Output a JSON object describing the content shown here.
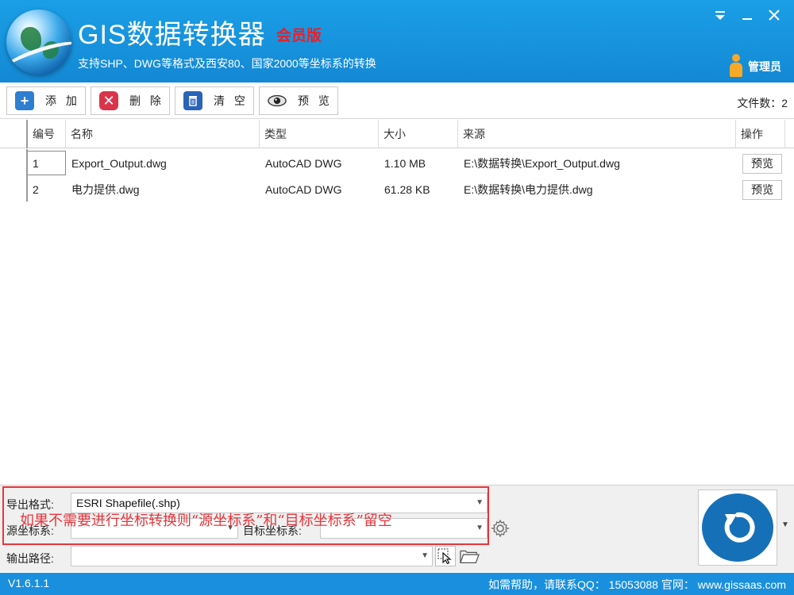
{
  "header": {
    "title": "GIS数据转换器",
    "edition": "会员版",
    "subtitle": "支持SHP、DWG等格式及西安80、国家2000等坐标系的转换",
    "user_label": "管理员",
    "window_buttons": {
      "menu": "menu-icon",
      "minimize": "minimize-icon",
      "close": "close-icon"
    }
  },
  "toolbar": {
    "add_label": "添 加",
    "delete_label": "删 除",
    "clear_label": "清 空",
    "preview_label": "预 览",
    "file_count": "文件数：2",
    "colors": {
      "add": "#2f7fd0",
      "delete": "#d9344a",
      "clear": "#2a64b8"
    }
  },
  "table": {
    "columns": [
      "编号",
      "名称",
      "类型",
      "大小",
      "来源",
      "操作"
    ],
    "rows": [
      {
        "num": "1",
        "name": "Export_Output.dwg",
        "type": "AutoCAD DWG",
        "size": "1.10 MB",
        "source": "E:\\数据转换\\Export_Output.dwg",
        "action": "预览"
      },
      {
        "num": "2",
        "name": "电力提供.dwg",
        "type": "AutoCAD DWG",
        "size": "61.28 KB",
        "source": "E:\\数据转换\\电力提供.dwg",
        "action": "预览"
      }
    ]
  },
  "bottom": {
    "export_format_label": "导出格式:",
    "export_format_value": "ESRI Shapefile(.shp)",
    "source_crs_label": "源坐标系:",
    "source_crs_value": "",
    "target_crs_label": "目标坐标系:",
    "target_crs_value": "",
    "output_path_label": "输出路径:",
    "output_path_value": "",
    "hint": "如果不需要进行坐标转换则“源坐标系”和“目标坐标系”留空"
  },
  "status": {
    "version": "V1.6.1.1",
    "help": "如需帮助，请联系QQ：  15053088   官网：  www.gissaas.com"
  },
  "colors": {
    "header": "#1a9fe6",
    "status": "#1a8fde",
    "accent_red": "#e8353b",
    "convert": "#1570b8"
  }
}
